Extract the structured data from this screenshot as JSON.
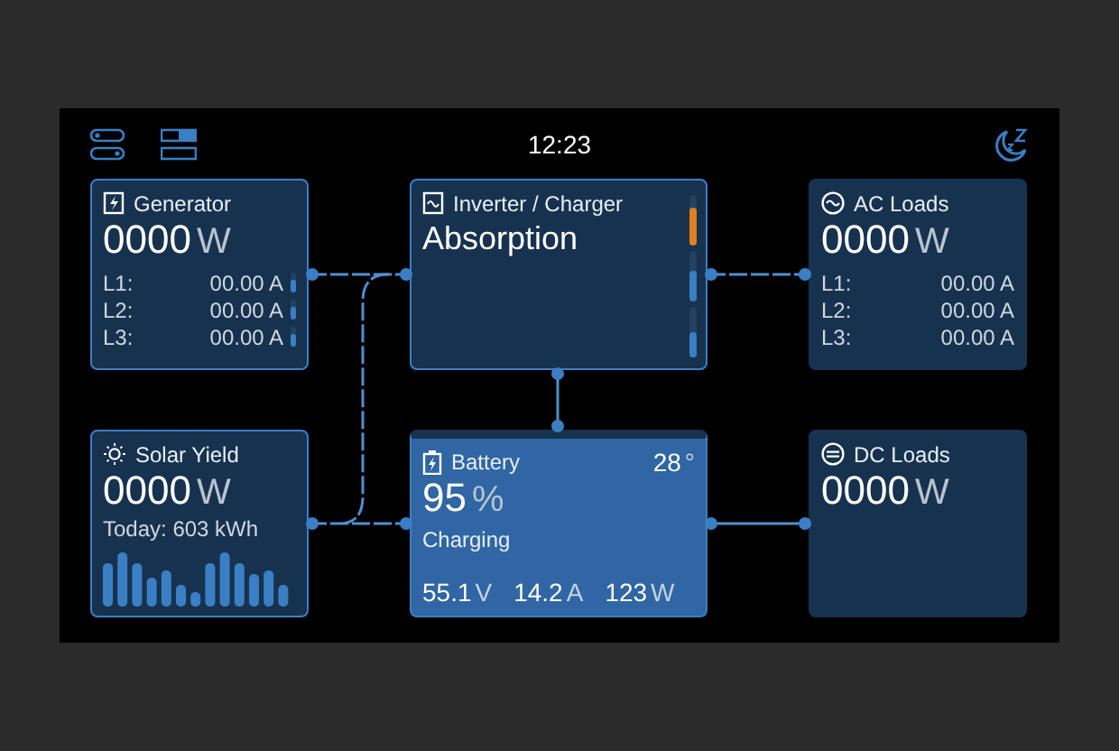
{
  "status_bar": {
    "time": "12:23"
  },
  "cards": [
    {
      "kind": "generator",
      "title": "Generator",
      "value": "0000",
      "unit": "W",
      "outlined": true,
      "phases": [
        {
          "label": "L1:",
          "value": "00.00",
          "unit": "A",
          "level": 0.6
        },
        {
          "label": "L2:",
          "value": "00.00",
          "unit": "A",
          "level": 0.6
        },
        {
          "label": "L3:",
          "value": "00.00",
          "unit": "A",
          "level": 0.6
        }
      ]
    },
    {
      "kind": "inverter",
      "title": "Inverter / Charger",
      "state": "Absorption",
      "outlined": true,
      "meters": [
        {
          "level": 0.75,
          "color": "#e0811e"
        },
        {
          "level": 0.6,
          "color": "#3a7fc4"
        },
        {
          "level": 0.5,
          "color": "#3a7fc4"
        }
      ]
    },
    {
      "kind": "ac_loads",
      "title": "AC Loads",
      "value": "0000",
      "unit": "W",
      "outlined": false,
      "phases": [
        {
          "label": "L1:",
          "value": "00.00",
          "unit": "A"
        },
        {
          "label": "L2:",
          "value": "00.00",
          "unit": "A"
        },
        {
          "label": "L3:",
          "value": "00.00",
          "unit": "A"
        }
      ]
    },
    {
      "kind": "solar",
      "title": "Solar Yield",
      "value": "0000",
      "unit": "W",
      "outlined": true,
      "today": "Today: 603 kWh"
    },
    {
      "kind": "battery",
      "title": "Battery",
      "temperature": "28",
      "temperature_unit": "°",
      "value": "95",
      "unit": "%",
      "status": "Charging",
      "outlined": true,
      "readings": [
        {
          "value": "55.1",
          "unit": "V"
        },
        {
          "value": "14.2",
          "unit": "A"
        },
        {
          "value": "123",
          "unit": "W"
        }
      ]
    },
    {
      "kind": "dc_loads",
      "title": "DC Loads",
      "value": "0000",
      "unit": "W",
      "outlined": false
    }
  ]
}
